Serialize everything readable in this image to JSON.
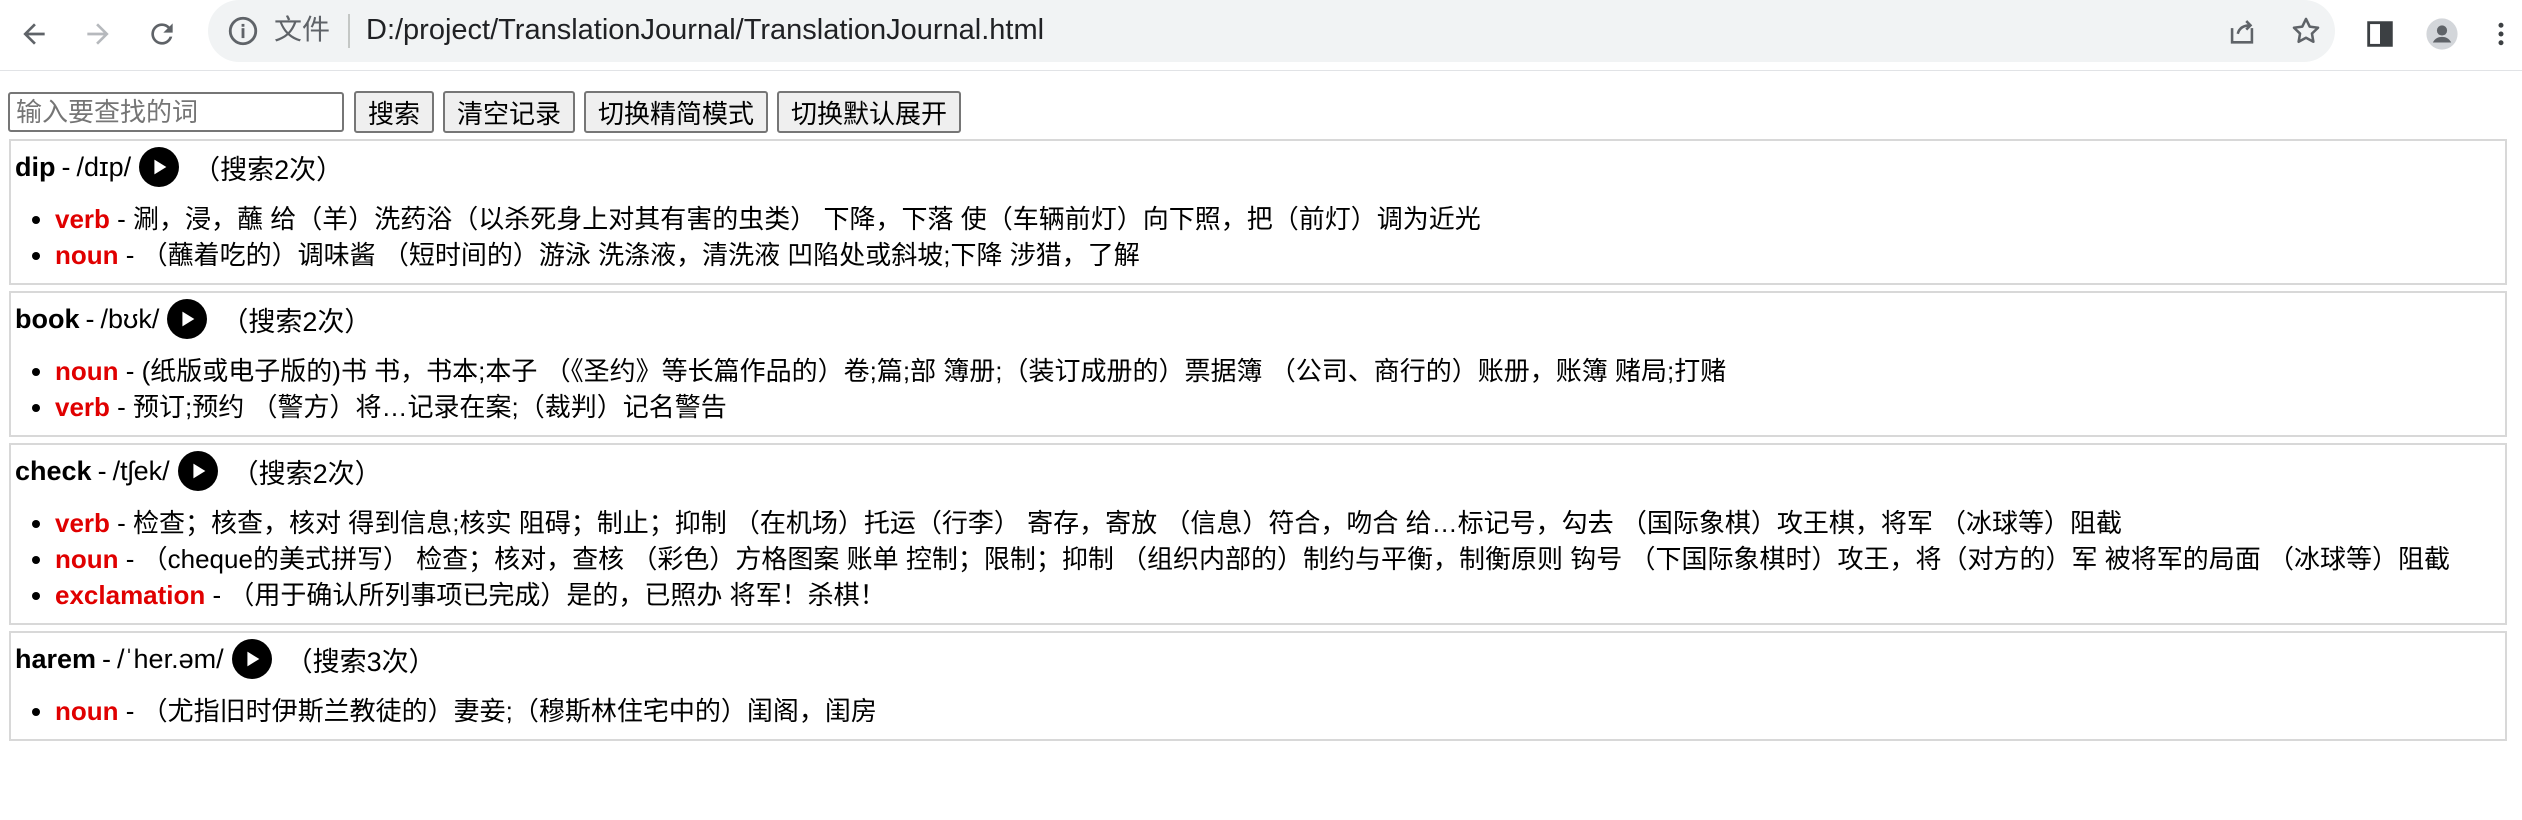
{
  "browser": {
    "info_chip": "文件",
    "url": "D:/project/TranslationJournal/TranslationJournal.html"
  },
  "controls": {
    "search_placeholder": "输入要查找的词",
    "search_value": "",
    "search_button": "搜索",
    "clear_button": "清空记录",
    "toggle_simple_button": "切换精简模式",
    "toggle_expand_button": "切换默认展开"
  },
  "entries": [
    {
      "word": "dip",
      "phonetic": "/dɪp/",
      "count": "（搜索2次）",
      "defs": [
        {
          "pos": "verb",
          "text": "涮，浸，蘸 给（羊）洗药浴（以杀死身上对其有害的虫类） 下降，下落 使（车辆前灯）向下照，把（前灯）调为近光"
        },
        {
          "pos": "noun",
          "text": "（蘸着吃的）调味酱 （短时间的）游泳 洗涤液，清洗液 凹陷处或斜坡;下降 涉猎，了解"
        }
      ]
    },
    {
      "word": "book",
      "phonetic": "/bʊk/",
      "count": "（搜索2次）",
      "defs": [
        {
          "pos": "noun",
          "text": "(纸版或电子版的)书 书，书本;本子 （《圣约》等长篇作品的）卷;篇;部 簿册;（装订成册的）票据簿 （公司、商行的）账册，账簿 赌局;打赌"
        },
        {
          "pos": "verb",
          "text": "预订;预约 （警方）将…记录在案;（裁判）记名警告"
        }
      ]
    },
    {
      "word": "check",
      "phonetic": "/tʃek/",
      "count": "（搜索2次）",
      "defs": [
        {
          "pos": "verb",
          "text": "检查；核查，核对 得到信息;核实 阻碍；制止；抑制 （在机场）托运（行李） 寄存，寄放 （信息）符合，吻合 给…标记号，勾去 （国际象棋）攻王棋，将军 （冰球等）阻截"
        },
        {
          "pos": "noun",
          "text": "（cheque的美式拼写） 检查；核对，查核 （彩色）方格图案 账单 控制；限制；抑制 （组织内部的）制约与平衡，制衡原则 钩号 （下国际象棋时）攻王，将（对方的）军 被将军的局面 （冰球等）阻截"
        },
        {
          "pos": "exclamation",
          "text": "（用于确认所列事项已完成）是的，已照办 将军！杀棋！"
        }
      ]
    },
    {
      "word": "harem",
      "phonetic": "/ˈher.əm/",
      "count": "（搜索3次）",
      "defs": [
        {
          "pos": "noun",
          "text": "（尤指旧时伊斯兰教徒的）妻妾;（穆斯林住宅中的）闺阁，闺房"
        }
      ]
    }
  ]
}
